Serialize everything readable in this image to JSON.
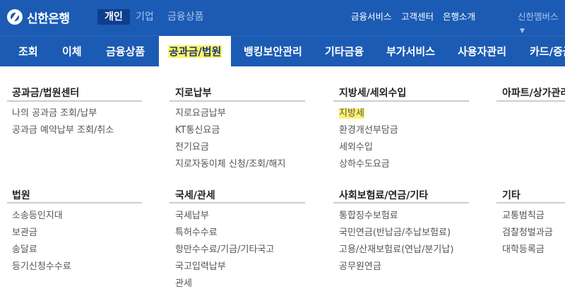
{
  "brand": {
    "name": "신한은행"
  },
  "segments": [
    {
      "label": "개인",
      "active": true
    },
    {
      "label": "기업",
      "active": false
    },
    {
      "label": "금융상품",
      "active": false
    }
  ],
  "util_links": [
    "금융서비스",
    "고객센터",
    "은행소개"
  ],
  "family_site": "신한멤버스",
  "gnb": [
    {
      "label": "조회"
    },
    {
      "label": "이체"
    },
    {
      "label": "금융상품"
    },
    {
      "label": "공과금/법원",
      "active": true
    },
    {
      "label": "뱅킹보안관리"
    },
    {
      "label": "기타금융"
    },
    {
      "label": "부가서비스"
    },
    {
      "label": "사용자관리"
    },
    {
      "label": "카드/증금"
    }
  ],
  "menu": {
    "col1_top": {
      "title": "공과금/법원센터",
      "items": [
        "나의 공과금 조회/납부",
        "공과금 예약납부 조회/취소"
      ]
    },
    "col2_top": {
      "title": "지로납부",
      "items": [
        "지로요금납부",
        "KT통신요금",
        "전기요금",
        "지로자동이체 신청/조회/해지"
      ]
    },
    "col3_top": {
      "title": "지방세/세외수입",
      "items": [
        "지방세",
        "환경개선부담금",
        "세외수입",
        "상하수도요금"
      ]
    },
    "col4_top": {
      "title": "아파트/상가관리비",
      "items": []
    },
    "col1_bot": {
      "title": "법원",
      "items": [
        "소송등인지대",
        "보관금",
        "송달료",
        "등기신청수수료"
      ]
    },
    "col2_bot": {
      "title": "국세/관세",
      "items": [
        "국세납부",
        "특허수수료",
        "항만수수료/기금/기타국고",
        "국고입력납부",
        "관세"
      ]
    },
    "col3_bot": {
      "title": "사회보험료/연금/기타",
      "items": [
        "통합징수보험료",
        "국민연금(반납금/추납보험료)",
        "고용/산재보험료(연납/분기납)",
        "공무원연금"
      ]
    },
    "col4_bot": {
      "title": "기타",
      "items": [
        "교통범칙금",
        "검찰청벌과금",
        "대학등록금"
      ]
    }
  },
  "colors": {
    "brand_blue": "#1c5bb4",
    "highlight": "#fff36b"
  }
}
